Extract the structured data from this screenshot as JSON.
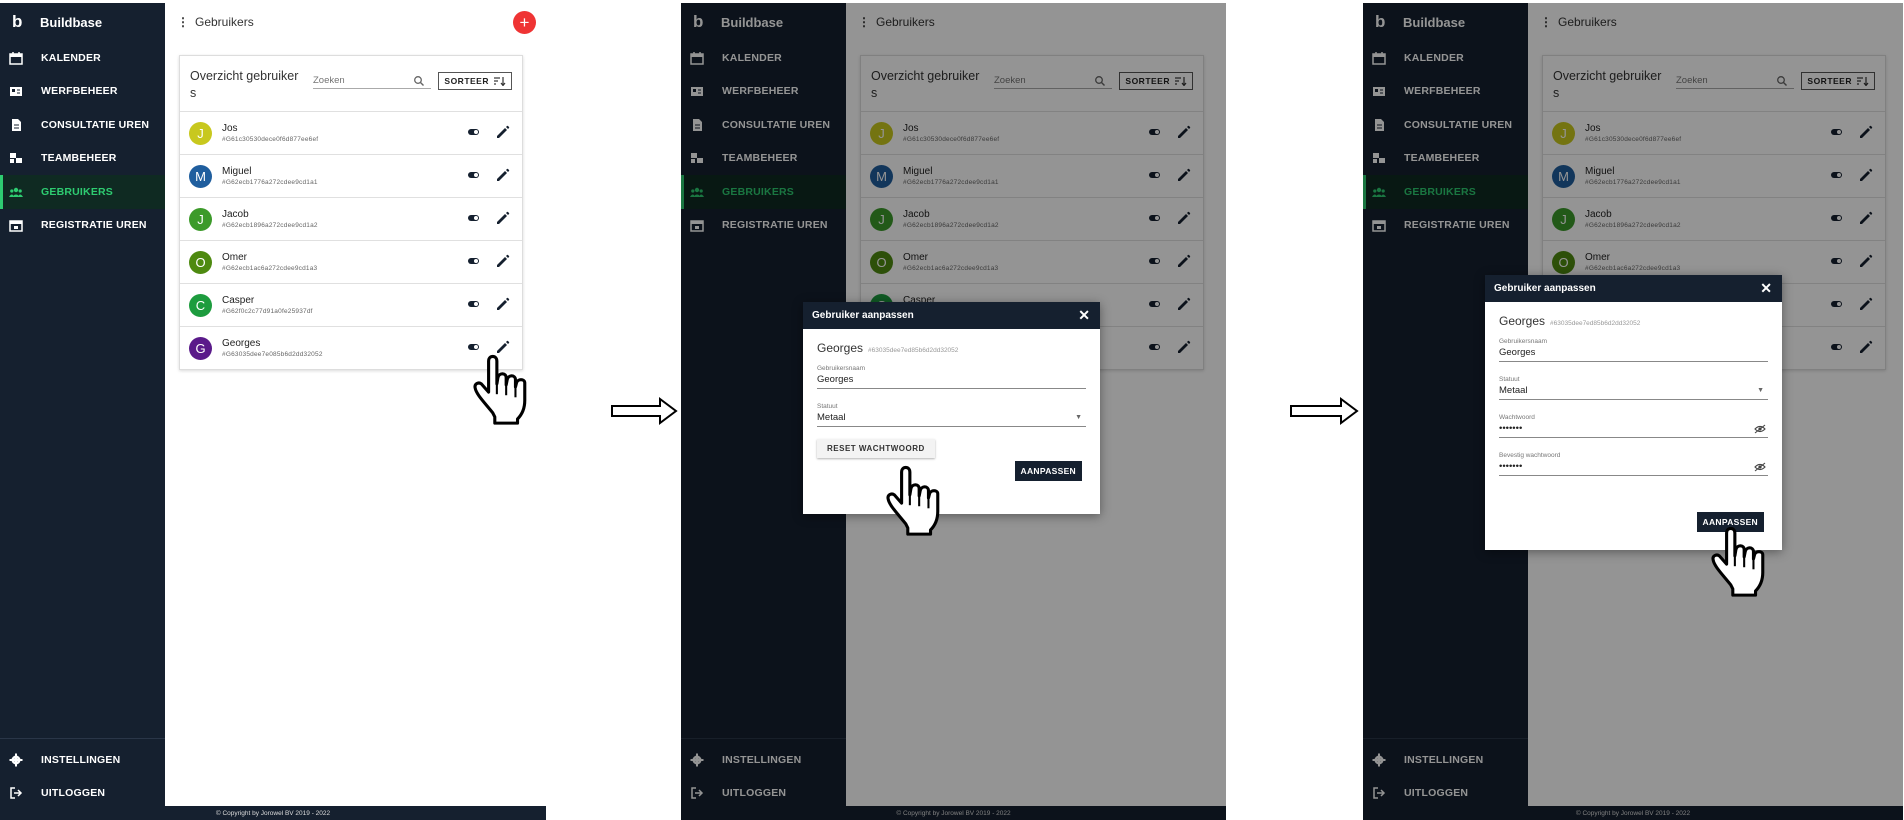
{
  "app": {
    "brand": "Buildbase",
    "brand_letter": "b",
    "page_title": "Gebruikers",
    "footer": "© Copyright by Jorowel BV 2019 - 2022"
  },
  "nav": {
    "items": [
      {
        "label": "KALENDER",
        "icon": "calendar-icon"
      },
      {
        "label": "WERFBEHEER",
        "icon": "id-card-icon"
      },
      {
        "label": "CONSULTATIE UREN",
        "icon": "document-icon"
      },
      {
        "label": "TEAMBEHEER",
        "icon": "team-icon"
      },
      {
        "label": "GEBRUIKERS",
        "icon": "users-icon",
        "active": true
      },
      {
        "label": "REGISTRATIE UREN",
        "icon": "calendar-check-icon"
      }
    ],
    "bottom": [
      {
        "label": "INSTELLINGEN",
        "icon": "gear-icon"
      },
      {
        "label": "UITLOGGEN",
        "icon": "logout-icon"
      }
    ]
  },
  "users_card": {
    "title": "Overzicht gebruiker s",
    "search_placeholder": "Zoeken",
    "sort_label": "SORTEER",
    "users": [
      {
        "initial": "J",
        "name": "Jos",
        "id": "#G61c30530dece0f6d877ee6ef",
        "color": "#c8c81e"
      },
      {
        "initial": "M",
        "name": "Miguel",
        "id": "#G62ecb1776a272cdee9cd1a1",
        "color": "#1f5e9e"
      },
      {
        "initial": "J",
        "name": "Jacob",
        "id": "#G62ecb1896a272cdee9cd1a2",
        "color": "#3c9a2a"
      },
      {
        "initial": "O",
        "name": "Omer",
        "id": "#G62ecb1ac6a272cdee9cd1a3",
        "color": "#4e8a10"
      },
      {
        "initial": "C",
        "name": "Casper",
        "id": "#G62f0c2c77d91a0fe25937df",
        "color": "#1d9c3e"
      },
      {
        "initial": "G",
        "name": "Georges",
        "id": "#G63035dee7e085b6d2dd32052",
        "color": "#5a1a8a"
      }
    ]
  },
  "dialog": {
    "title": "Gebruiker aanpassen",
    "user_name": "Georges",
    "user_id": "#63035dee7ed85b6d2dd32052",
    "username_label": "Gebruikersnaam",
    "username_value": "Georges",
    "status_label": "Statuut",
    "status_value": "Metaal",
    "reset_label": "RESET WACHTWOORD",
    "password_label": "Wachtwoord",
    "password_value": "•••••••",
    "confirm_label": "Bevestig wachtwoord",
    "confirm_value": "•••••••",
    "save_label": "AANPASSEN"
  },
  "colors": {
    "sidebar": "#15202f",
    "active": "#2ecc71",
    "fab": "#ef3434"
  }
}
